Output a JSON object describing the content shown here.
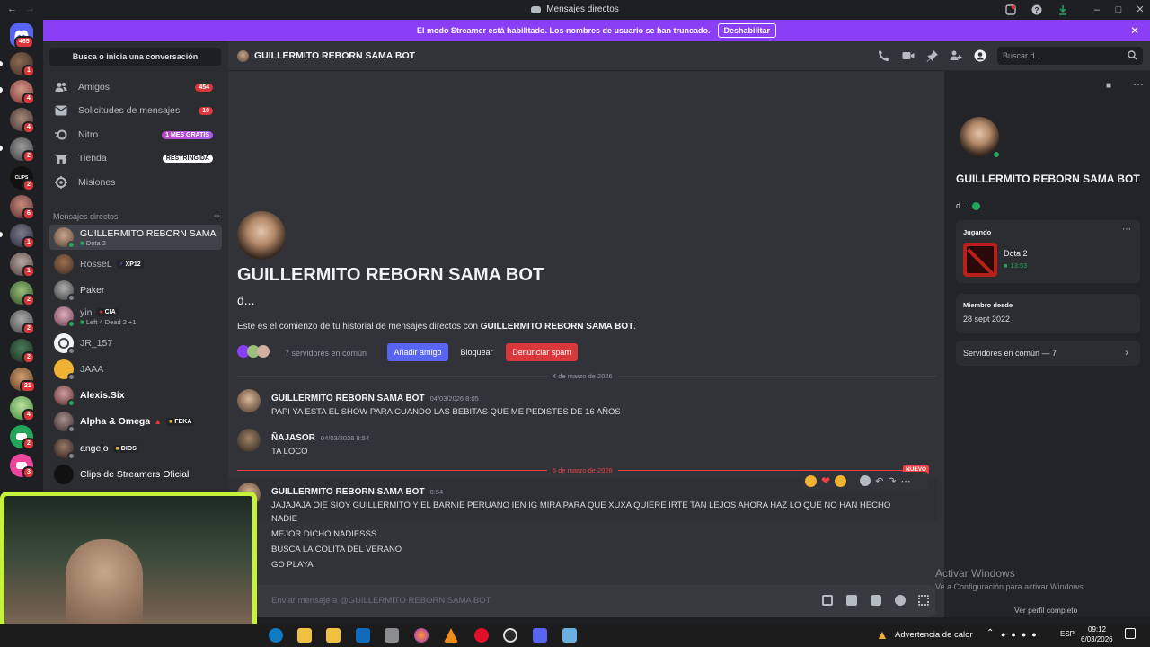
{
  "titlebar": {
    "title": "Mensajes directos"
  },
  "banner": {
    "text": "El modo Streamer está habilitado. Los nombres de usuario se han truncado.",
    "button": "Deshabilitar",
    "color": "#8a3ef5"
  },
  "rail": {
    "home_badge": "465",
    "badges": [
      "1",
      "4",
      "4",
      "2",
      "2",
      "6",
      "1",
      "1",
      "2",
      "2",
      "2",
      "21",
      "4",
      "2",
      "3"
    ]
  },
  "sidebar": {
    "search_label": "Busca o inicia una conversación",
    "nav": [
      {
        "label": "Amigos",
        "badge": "454",
        "icon": "friends-icon"
      },
      {
        "label": "Solicitudes de mensajes",
        "badge": "10",
        "icon": "mail-icon"
      },
      {
        "label": "Nitro",
        "tag": "1 MES GRATIS",
        "icon": "nitro-icon"
      },
      {
        "label": "Tienda",
        "tag": "RESTRINGIDA",
        "icon": "shop-icon"
      },
      {
        "label": "Misiones",
        "icon": "quests-icon"
      }
    ],
    "dm_header": "Mensajes directos",
    "dm_add": "+",
    "dms": [
      {
        "name": "GUILLERMITO REBORN SAMA ...",
        "sub": "Dota 2",
        "status": "online"
      },
      {
        "name": "RosseL",
        "chip": "XP12",
        "status": "none"
      },
      {
        "name": "Paker",
        "status": "offline"
      },
      {
        "name": "yin",
        "chip": "CIA",
        "sub": "Left 4 Dead 2 +1",
        "status": "online"
      },
      {
        "name": "JR_157",
        "status": "offline"
      },
      {
        "name": "JAAA",
        "status": "offline"
      },
      {
        "name": "Alexis.Six",
        "status": "online"
      },
      {
        "name": "Alpha & Omega",
        "chip": "FEKA",
        "status": "offline"
      },
      {
        "name": "angelo",
        "chip": "DIOS",
        "status": "offline"
      },
      {
        "name": "Clips de Streamers Oficial",
        "status": "none"
      }
    ]
  },
  "header": {
    "channel": "GUILLERMITO REBORN SAMA BOT",
    "search_placeholder": "Buscar d..."
  },
  "intro": {
    "name": "GUILLERMITO REBORN SAMA BOT",
    "handle": "d...",
    "text_prefix": "Este es el comienzo de tu historial de mensajes directos con ",
    "text_name": "GUILLERMITO REBORN SAMA BOT",
    "text_suffix": ".",
    "mutual": "7 servidores en común",
    "add_friend": "Añadir amigo",
    "block": "Bloquear",
    "report": "Denunciar spam"
  },
  "dividers": {
    "first": "4 de marzo de 2026",
    "second": "6 de marzo de 2026",
    "new_tag": "NUEVO"
  },
  "messages": [
    {
      "author": "GUILLERMITO REBORN SAMA BOT",
      "time": "04/03/2026 8:05",
      "lines": [
        "PAPI YA ESTA EL SHOW PARA CUANDO LAS BEBITAS QUE ME PEDISTES DE 16 AÑOS"
      ]
    },
    {
      "author": "ÑAJASOR",
      "time": "04/03/2026 8:54",
      "lines": [
        "TA LOCO"
      ]
    },
    {
      "author": "GUILLERMITO REBORN SAMA BOT",
      "time": "8:54",
      "lines": [
        "JAJAJAJA OIE SIOY GUILLERMITO Y EL BARNIE PERUANO IEN IG MIRA PARA QUE XUXA QUIERE IRTE TAN LEJOS AHORA HAZ LO QUE NO HAN HECHO",
        "NADIE",
        "MEJOR DICHO NADIESSS",
        "BUSCA LA COLITA DEL VERANO",
        "GO PLAYA"
      ]
    }
  ],
  "composer": {
    "placeholder": "Enviar mensaje a @GUILLERMITO REBORN SAMA BOT"
  },
  "profile": {
    "name": "GUILLERMITO REBORN SAMA BOT",
    "handle": "d...",
    "playing_label": "Jugando",
    "game": "Dota 2",
    "game_time": "13:53",
    "member_label": "Miembro desde",
    "member_date": "28 sept 2022",
    "mutual_servers": "Servidores en común — 7",
    "full_profile": "Ver perfil completo"
  },
  "watermark": {
    "title": "Activar Windows",
    "sub": "Ve a Configuración para activar Windows."
  },
  "taskbar": {
    "weather": "Advertencia de calor",
    "lang": "ESP",
    "time": "09:12",
    "date": "6/03/2026"
  }
}
